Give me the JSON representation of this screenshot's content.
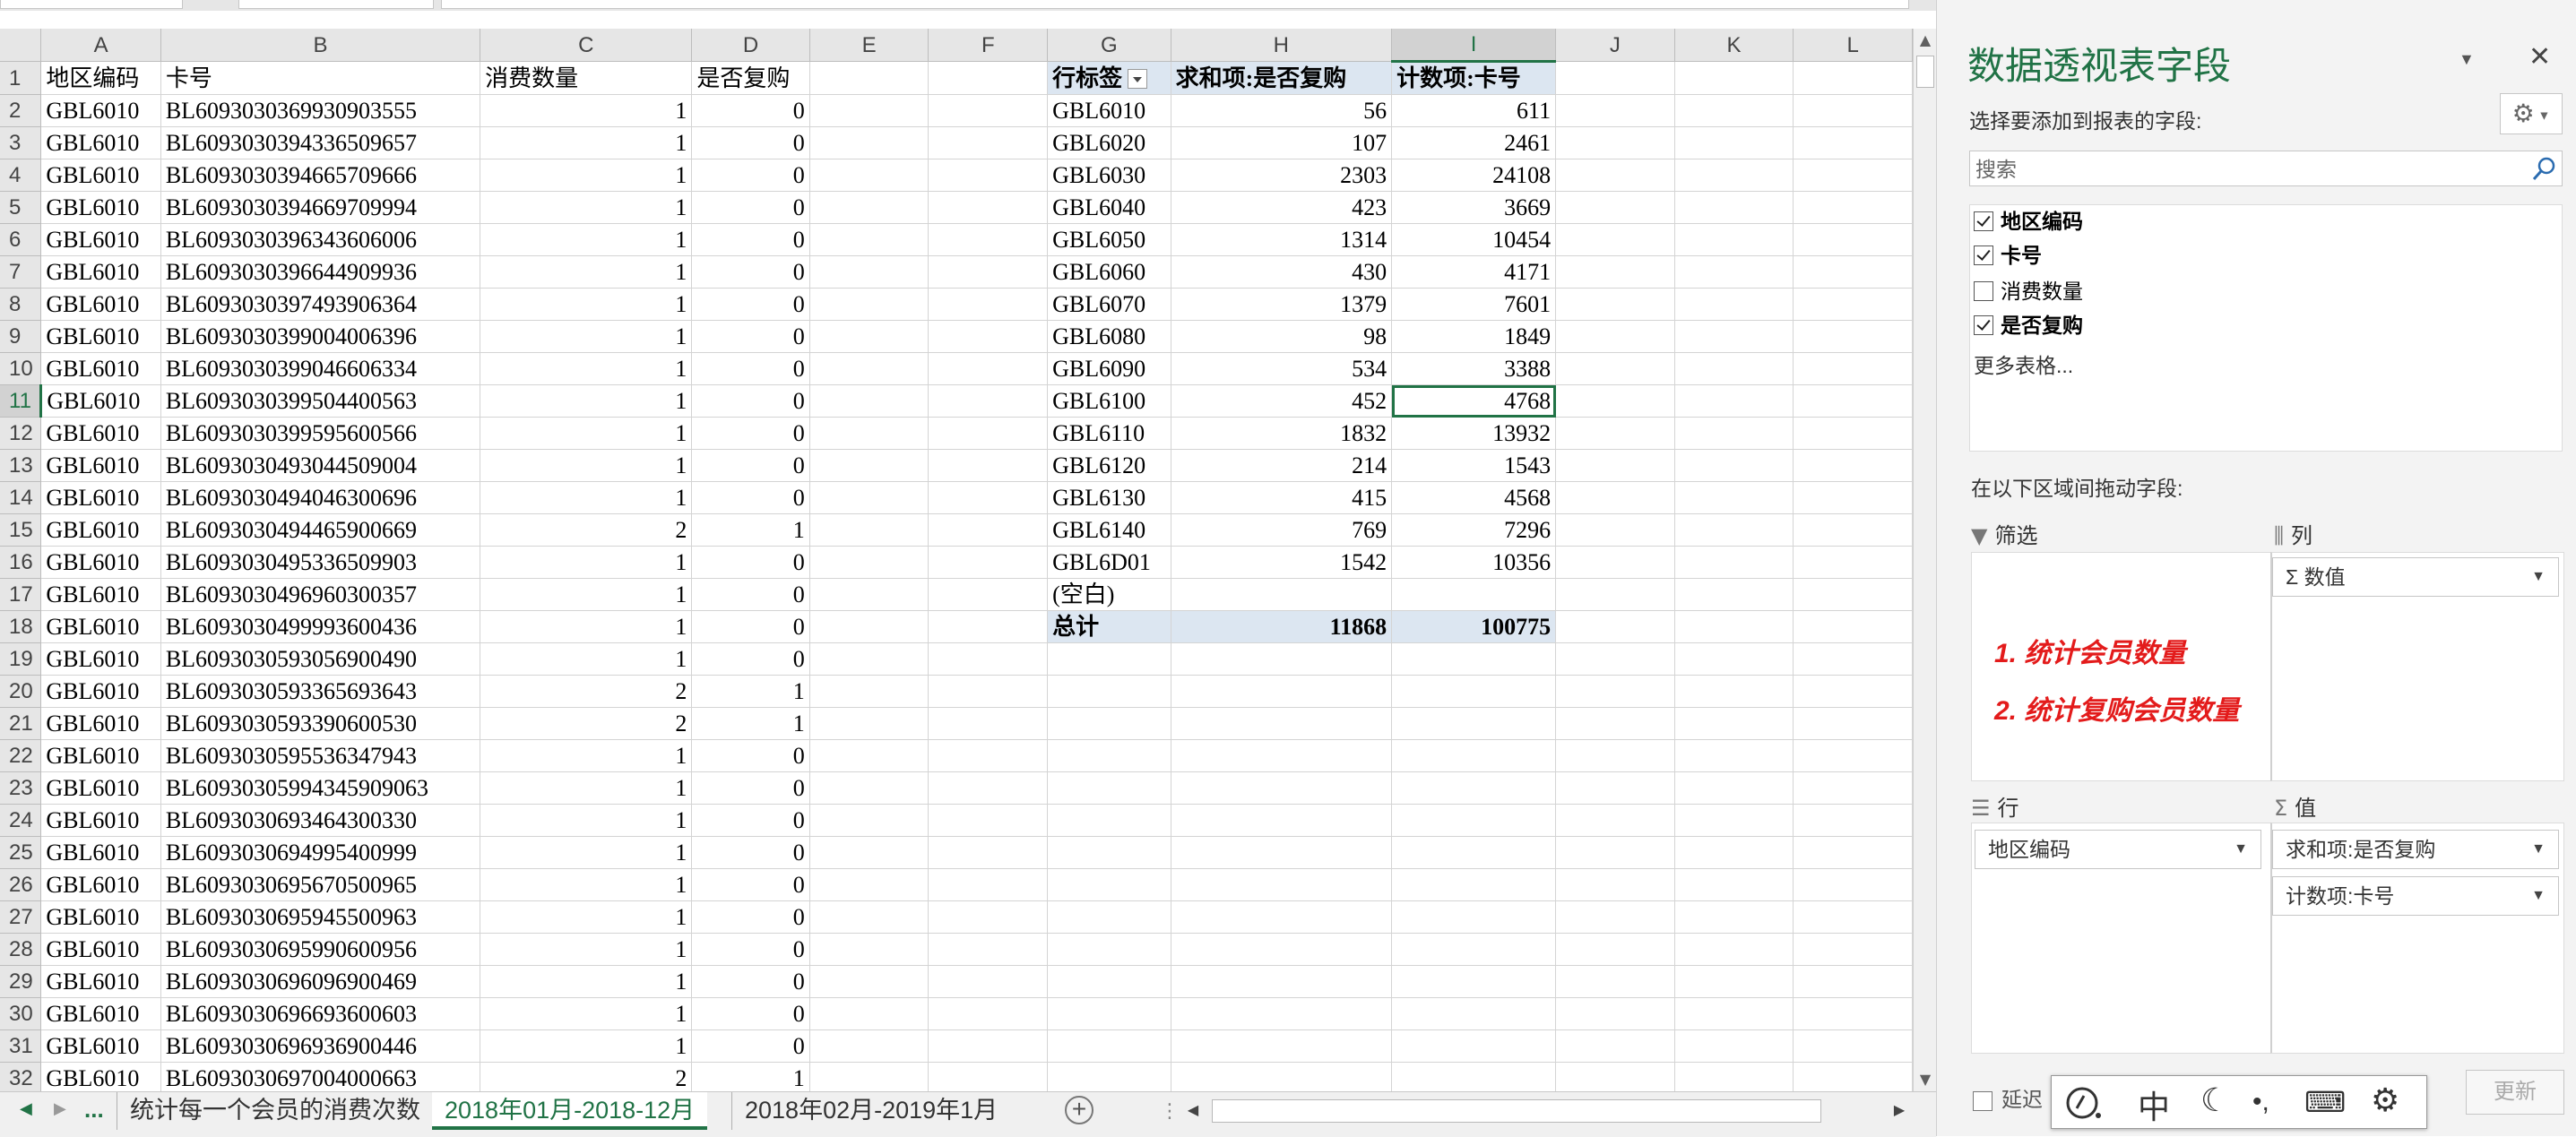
{
  "columns": [
    "A",
    "B",
    "C",
    "D",
    "E",
    "F",
    "G",
    "H",
    "I",
    "J",
    "K",
    "L"
  ],
  "row_numbers": [
    "1",
    "2",
    "3",
    "4",
    "5",
    "6",
    "7",
    "8",
    "9",
    "10",
    "11",
    "12",
    "13",
    "14",
    "15",
    "16",
    "17",
    "18",
    "19",
    "20",
    "21",
    "22",
    "23",
    "24",
    "25",
    "26",
    "27",
    "28",
    "29",
    "30",
    "31",
    "32"
  ],
  "source_headers": [
    "地区编码",
    "卡号",
    "消费数量",
    "是否复购"
  ],
  "source_rows": [
    [
      "GBL6010",
      "BL6093030369930903555",
      "1",
      "0"
    ],
    [
      "GBL6010",
      "BL6093030394336509657",
      "1",
      "0"
    ],
    [
      "GBL6010",
      "BL6093030394665709666",
      "1",
      "0"
    ],
    [
      "GBL6010",
      "BL6093030394669709994",
      "1",
      "0"
    ],
    [
      "GBL6010",
      "BL6093030396343606006",
      "1",
      "0"
    ],
    [
      "GBL6010",
      "BL6093030396644909936",
      "1",
      "0"
    ],
    [
      "GBL6010",
      "BL6093030397493906364",
      "1",
      "0"
    ],
    [
      "GBL6010",
      "BL6093030399004006396",
      "1",
      "0"
    ],
    [
      "GBL6010",
      "BL6093030399046606334",
      "1",
      "0"
    ],
    [
      "GBL6010",
      "BL6093030399504400563",
      "1",
      "0"
    ],
    [
      "GBL6010",
      "BL6093030399595600566",
      "1",
      "0"
    ],
    [
      "GBL6010",
      "BL6093030493044509004",
      "1",
      "0"
    ],
    [
      "GBL6010",
      "BL6093030494046300696",
      "1",
      "0"
    ],
    [
      "GBL6010",
      "BL6093030494465900669",
      "2",
      "1"
    ],
    [
      "GBL6010",
      "BL6093030495336509903",
      "1",
      "0"
    ],
    [
      "GBL6010",
      "BL6093030496960300357",
      "1",
      "0"
    ],
    [
      "GBL6010",
      "BL6093030499993600436",
      "1",
      "0"
    ],
    [
      "GBL6010",
      "BL6093030593056900490",
      "1",
      "0"
    ],
    [
      "GBL6010",
      "BL6093030593365693643",
      "2",
      "1"
    ],
    [
      "GBL6010",
      "BL6093030593390600530",
      "2",
      "1"
    ],
    [
      "GBL6010",
      "BL6093030595536347943",
      "1",
      "0"
    ],
    [
      "GBL6010",
      "BL60930305994345909063",
      "1",
      "0"
    ],
    [
      "GBL6010",
      "BL6093030693464300330",
      "1",
      "0"
    ],
    [
      "GBL6010",
      "BL6093030694995400999",
      "1",
      "0"
    ],
    [
      "GBL6010",
      "BL6093030695670500965",
      "1",
      "0"
    ],
    [
      "GBL6010",
      "BL6093030695945500963",
      "1",
      "0"
    ],
    [
      "GBL6010",
      "BL6093030695990600956",
      "1",
      "0"
    ],
    [
      "GBL6010",
      "BL6093030696096900469",
      "1",
      "0"
    ],
    [
      "GBL6010",
      "BL6093030696693600603",
      "1",
      "0"
    ],
    [
      "GBL6010",
      "BL6093030696936900446",
      "1",
      "0"
    ],
    [
      "GBL6010",
      "BL6093030697004000663",
      "2",
      "1"
    ]
  ],
  "pivot": {
    "headers": [
      "行标签",
      "求和项:是否复购",
      "计数项:卡号"
    ],
    "rows": [
      [
        "GBL6010",
        "56",
        "611"
      ],
      [
        "GBL6020",
        "107",
        "2461"
      ],
      [
        "GBL6030",
        "2303",
        "24108"
      ],
      [
        "GBL6040",
        "423",
        "3669"
      ],
      [
        "GBL6050",
        "1314",
        "10454"
      ],
      [
        "GBL6060",
        "430",
        "4171"
      ],
      [
        "GBL6070",
        "1379",
        "7601"
      ],
      [
        "GBL6080",
        "98",
        "1849"
      ],
      [
        "GBL6090",
        "534",
        "3388"
      ],
      [
        "GBL6100",
        "452",
        "4768"
      ],
      [
        "GBL6110",
        "1832",
        "13932"
      ],
      [
        "GBL6120",
        "214",
        "1543"
      ],
      [
        "GBL6130",
        "415",
        "4568"
      ],
      [
        "GBL6140",
        "769",
        "7296"
      ],
      [
        "GBL6D01",
        "1542",
        "10356"
      ],
      [
        "(空白)",
        "",
        ""
      ]
    ],
    "total": [
      "总计",
      "11868",
      "100775"
    ]
  },
  "tabs": {
    "ellipsis": "...",
    "sheet1": "统计每一个会员的消费次数",
    "sheet2": "2018年01月-2018-12月",
    "sheet3": "2018年02月-2019年1月"
  },
  "pane": {
    "title": "数据透视表字段",
    "subtitle": "选择要添加到报表的字段:",
    "search_placeholder": "搜索",
    "fields": [
      {
        "label": "地区编码",
        "checked": true
      },
      {
        "label": "卡号",
        "checked": true
      },
      {
        "label": "消费数量",
        "checked": false
      },
      {
        "label": "是否复购",
        "checked": true
      }
    ],
    "more_tables": "更多表格...",
    "drag_label": "在以下区域间拖动字段:",
    "filter_label": "筛选",
    "columns_label": "列",
    "rows_label": "行",
    "values_label": "值",
    "columns_field": "Σ 数值",
    "rows_field": "地区编码",
    "value_fields": [
      "求和项:是否复购",
      "计数项:卡号"
    ],
    "notes": [
      "1. 统计会员数量",
      "2. 统计复购会员数量"
    ],
    "defer_label": "延迟",
    "update_label": "更新"
  },
  "ime": {
    "mode": "中"
  }
}
